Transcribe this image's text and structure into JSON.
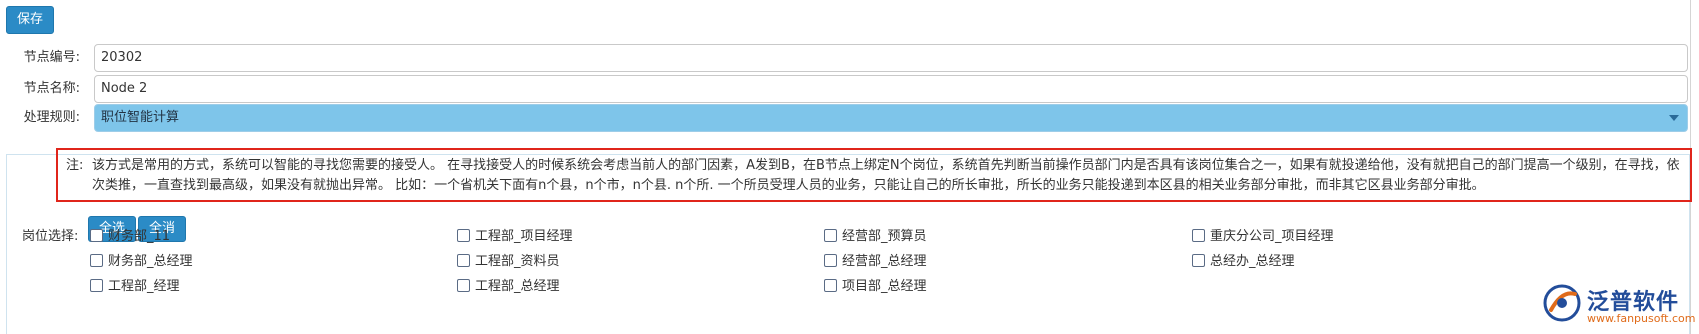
{
  "toolbar": {
    "save_label": "保存"
  },
  "form": {
    "node_no_label": "节点编号:",
    "node_no_value": "20302",
    "node_name_label": "节点名称:",
    "node_name_value": "Node 2",
    "rule_label": "处理规则:",
    "rule_value": "职位智能计算"
  },
  "note": {
    "label": "注:",
    "text": "该方式是常用的方式，系统可以智能的寻找您需要的接受人。 在寻找接受人的时候系统会考虑当前人的部门因素，A发到B，在B节点上绑定N个岗位，系统首先判断当前操作员部门内是否具有该岗位集合之一，如果有就投递给他，没有就把自己的部门提高一个级别，在寻找，依次类推，一直查找到最高级，如果没有就抛出异常。 比如：一个省机关下面有n个县，n个市，n个县. n个所. 一个所员受理人员的业务，只能让自己的所长审批，所长的业务只能投递到本区县的相关业务部分审批，而非其它区县业务部分审批。"
  },
  "buttons": {
    "select_all": "全选",
    "deselect_all": "全消"
  },
  "positions": {
    "label": "岗位选择:",
    "items": [
      "财务部_11",
      "工程部_项目经理",
      "经营部_预算员",
      "重庆分公司_项目经理",
      "财务部_总经理",
      "工程部_资料员",
      "经营部_总经理",
      "总经办_总经理",
      "工程部_经理",
      "工程部_总经理",
      "项目部_总经理"
    ]
  },
  "logo": {
    "name": "泛普软件",
    "url": "www.fanpusoft.com"
  },
  "colors": {
    "accent": "#2b8bc6",
    "select_bg": "#7ec5ea",
    "highlight_border": "#e0251b",
    "logo_blue": "#234d9a",
    "logo_orange": "#e06b1a"
  }
}
